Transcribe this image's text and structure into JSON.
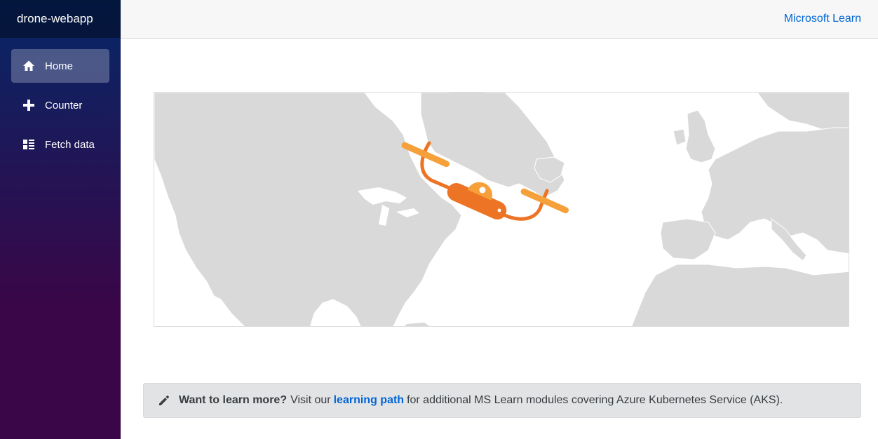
{
  "app": {
    "brand": "drone-webapp"
  },
  "sidebar": {
    "items": [
      {
        "label": "Home",
        "icon": "home-icon",
        "active": true
      },
      {
        "label": "Counter",
        "icon": "plus-icon",
        "active": false
      },
      {
        "label": "Fetch data",
        "icon": "list-icon",
        "active": false
      }
    ]
  },
  "header": {
    "link_label": "Microsoft Learn"
  },
  "alert": {
    "icon": "pencil-icon",
    "bold_text": "Want to learn more?",
    "text_before_link": "Visit our",
    "link_label": "learning path",
    "text_after_link": "for additional MS Learn modules covering Azure Kubernetes Service (AKS)."
  },
  "colors": {
    "sidebar_top": "#052767",
    "sidebar_bottom": "#3a0647",
    "link": "#0366d6",
    "land": "#d9d9d9",
    "drone_dark": "#ec7424",
    "drone_light": "#f5a03a"
  }
}
